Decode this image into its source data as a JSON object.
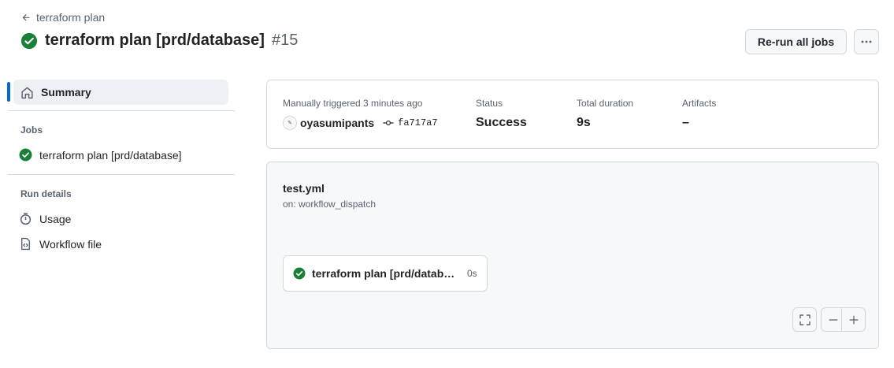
{
  "header": {
    "back_label": "terraform plan",
    "title": "terraform plan [prd/database]",
    "run_number": "#15",
    "rerun_label": "Re-run all jobs",
    "status_icon": "check-circle-fill-icon"
  },
  "sidebar": {
    "summary_label": "Summary",
    "jobs_heading": "Jobs",
    "jobs": [
      {
        "label": "terraform plan [prd/database]",
        "status": "success"
      }
    ],
    "run_details_heading": "Run details",
    "run_details": [
      {
        "label": "Usage",
        "icon": "stopwatch-icon"
      },
      {
        "label": "Workflow file",
        "icon": "file-code-icon"
      }
    ]
  },
  "summary": {
    "trigger_label": "Manually triggered 3 minutes ago",
    "username": "oyasumipants",
    "commit": "fa717a7",
    "status_label": "Status",
    "status_value": "Success",
    "duration_label": "Total duration",
    "duration_value": "9s",
    "artifacts_label": "Artifacts",
    "artifacts_value": "–"
  },
  "workflow": {
    "file": "test.yml",
    "trigger": "on: workflow_dispatch",
    "job": {
      "name": "terraform plan [prd/database]",
      "duration": "0s"
    }
  },
  "colors": {
    "success": "#1a7f37",
    "accent": "#0969da",
    "muted": "#59636e",
    "border": "#d1d9e0"
  }
}
